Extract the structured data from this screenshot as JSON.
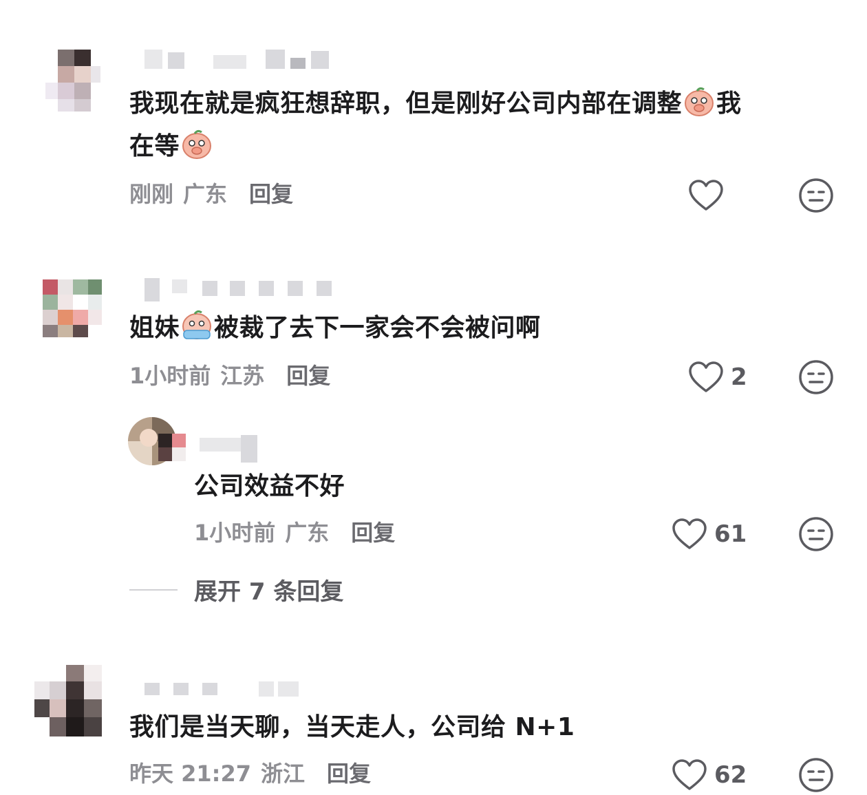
{
  "comments": [
    {
      "text_part1": "我现在就是疯狂想辞职，但是刚好公司内部在调整",
      "text_part2": "我",
      "text_part3": "在等",
      "time": "刚刚",
      "location": "广东",
      "reply_label": "回复",
      "likes": ""
    },
    {
      "text_part1": "姐妹",
      "text_part2": "被裁了去下一家会不会被问啊",
      "time": "1小时前",
      "location": "江苏",
      "reply_label": "回复",
      "likes": "2",
      "replies": [
        {
          "text": "公司效益不好",
          "time": "1小时前",
          "location": "广东",
          "reply_label": "回复",
          "likes": "61"
        }
      ],
      "expand_label": "展开 7 条回复"
    },
    {
      "text": "我们是当天聊，当天走人，公司给 N+1",
      "time": "昨天 21:27",
      "location": "浙江",
      "reply_label": "回复",
      "likes": "62"
    }
  ],
  "icons": {
    "like": "heart-outline-icon",
    "dislike": "neutral-face-icon",
    "emoji_shy": "peach-cover-mouth-emoji",
    "emoji_cry": "peach-crying-emoji"
  },
  "colors": {
    "text": "#1c1c1e",
    "meta": "#8e8e93",
    "icon": "#5b5b60"
  }
}
